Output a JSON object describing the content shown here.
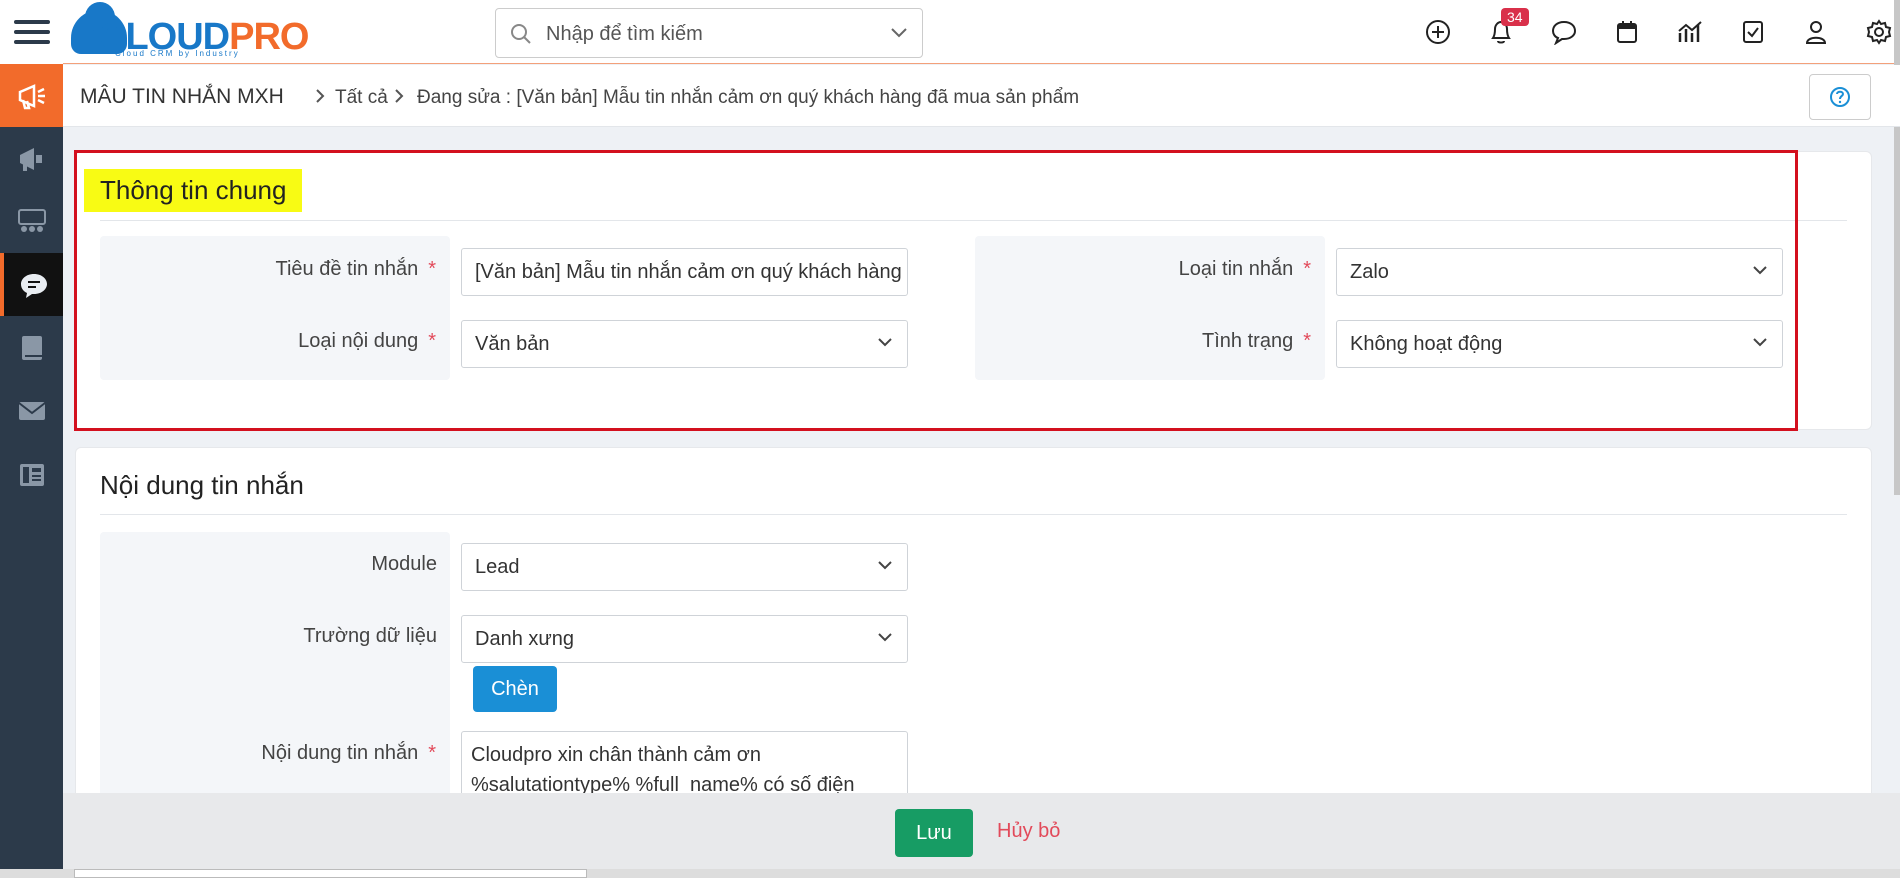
{
  "app": {
    "logo_text_blue": "CLOUD",
    "logo_text_orange": "PRO",
    "logo_tagline": "Cloud CRM by Industry"
  },
  "search": {
    "placeholder": "Nhập để tìm kiếm"
  },
  "header_icons": [
    "plus-circle-icon",
    "bell-icon",
    "chat-icon",
    "calendar-icon",
    "analytics-icon",
    "task-check-icon",
    "user-icon",
    "gear-icon"
  ],
  "notifications": {
    "count": "34"
  },
  "sidebar": {
    "items": [
      "megaphone-icon",
      "campaign-icon",
      "group-meeting-icon",
      "message-bubble-icon",
      "book-icon",
      "mail-icon",
      "fax-icon"
    ]
  },
  "breadcrumb": {
    "module": "MÂU TIN NHẮN MXH",
    "all": "Tất cả",
    "editing": "Đang sửa : [Văn bản] Mẫu tin nhắn cảm ơn quý khách hàng đã mua sản phẩm"
  },
  "general": {
    "title": "Thông tin chung",
    "subject_label": "Tiêu đề tin nhắn",
    "subject_value": "[Văn bản] Mẫu tin nhắn cảm ơn quý khách hàng đã mua sản phẩm",
    "content_type_label": "Loại nội dung",
    "content_type_value": "Văn bản",
    "message_type_label": "Loại tin nhắn",
    "message_type_value": "Zalo",
    "status_label": "Tình trạng",
    "status_value": "Không hoạt động",
    "required_mark": "*"
  },
  "content": {
    "title": "Nội dung tin nhắn",
    "module_label": "Module",
    "module_value": "Lead",
    "field_label": "Trường dữ liệu",
    "field_value": "Danh xưng",
    "insert_label": "Chèn",
    "message_label": "Nội dung tin nhắn",
    "message_line1": "Cloudpro xin chân thành cảm ơn",
    "message_line2": "%salutationtype% %full_name% có số điện"
  },
  "footer": {
    "save_label": "Lưu",
    "cancel_label": "Hủy bỏ"
  },
  "colors": {
    "accent": "#f26b2b",
    "brand_blue": "#1878c8",
    "save_green": "#179c64",
    "insert_blue": "#1a8fd6",
    "highlight": "#f8fb14",
    "annotation_red": "#d3101e"
  }
}
